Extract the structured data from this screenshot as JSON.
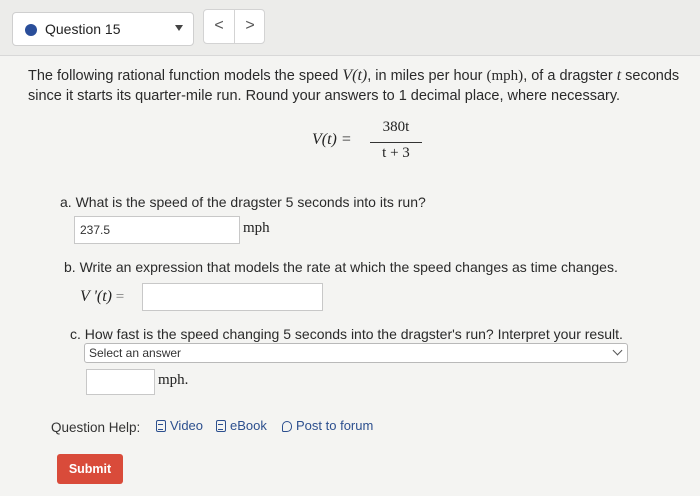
{
  "header": {
    "question_selector": "Question 15",
    "prev_symbol": "<",
    "next_symbol": ">"
  },
  "prompt": {
    "part1": "The following rational function models the speed ",
    "func": "V(t)",
    "part2": ", in miles per hour ",
    "unit": "(mph)",
    "part3": ", of a dragster ",
    "var": "t",
    "part4": " seconds since it starts its quarter-mile run. Round your answers to 1 decimal place, where necessary."
  },
  "formula": {
    "lhs": "V(t) =",
    "numerator": "380t",
    "denominator": "t + 3"
  },
  "part_a": {
    "question": "a. What is the speed of the dragster 5 seconds into its run?",
    "answer": "237.5",
    "unit": "mph"
  },
  "part_b": {
    "question": "b. Write an expression that models the rate at which the speed changes as time changes.",
    "label": "V '(t)",
    "equals": "=",
    "answer": ""
  },
  "part_c": {
    "question": "c. How fast is the speed changing 5 seconds into the dragster's run? Interpret your result.",
    "dropdown_selected": "Select an answer",
    "answer": "",
    "unit": "mph."
  },
  "help": {
    "label": "Question Help:",
    "video": "Video",
    "ebook": "eBook",
    "forum": "Post to forum"
  },
  "submit_label": "Submit",
  "colors": {
    "accent_dot": "#2a4e9a",
    "link": "#2c4f8e",
    "submit_bg": "#d94b3a"
  }
}
